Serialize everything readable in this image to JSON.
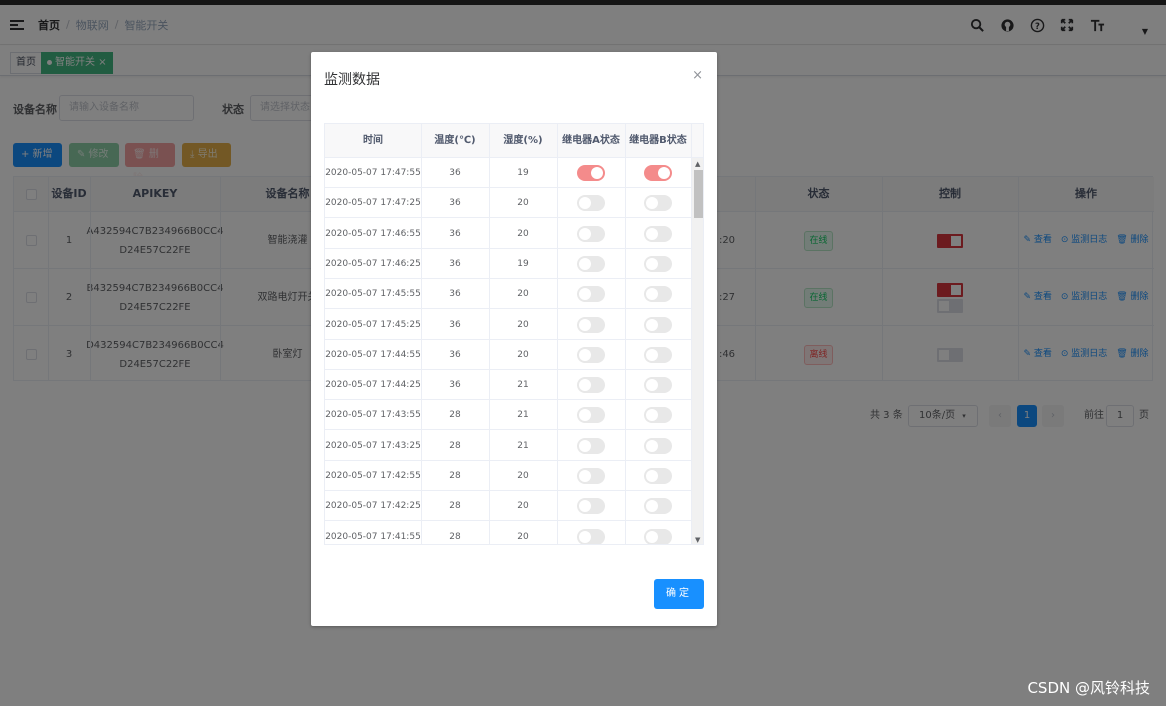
{
  "navbar": {
    "breadcrumbs": [
      "首页",
      "物联网",
      "智能开关"
    ]
  },
  "tags": [
    "首页",
    "智能开关"
  ],
  "search": {
    "device_name_label": "设备名称",
    "device_name_placeholder": "请输入设备名称",
    "status_label": "状态",
    "status_placeholder": "请选择状态"
  },
  "toolbar": {
    "add": "+ 新增",
    "edit": "✎ 修改",
    "delete": "🗑 删除",
    "export": "⤓ 导出"
  },
  "table": {
    "headers": [
      "设备ID",
      "APIKEY",
      "设备名称",
      "状态",
      "控制",
      "操作"
    ],
    "rows": [
      {
        "id": "1",
        "apikey_1": "A432594C7B234966B0CC4",
        "apikey_2": "D24E57C22FE",
        "name": "智能浇灌",
        "time_tail": ":20",
        "status": "在线",
        "status_type": "online",
        "switches": [
          "on"
        ]
      },
      {
        "id": "2",
        "apikey_1": "B432594C7B234966B0CC4",
        "apikey_2": "D24E57C22FE",
        "name": "双路电灯开关",
        "time_tail": ":27",
        "status": "在线",
        "status_type": "online",
        "switches": [
          "on",
          "off"
        ]
      },
      {
        "id": "3",
        "apikey_1": "D432594C7B234966B0CC4",
        "apikey_2": "D24E57C22FE",
        "name": "卧室灯",
        "time_tail": ":46",
        "status": "离线",
        "status_type": "offline",
        "switches": [
          "off"
        ]
      }
    ],
    "ops": [
      "✎ 查看",
      "⊙ 监测日志",
      "🗑 删除"
    ]
  },
  "pagination": {
    "total": "共 3 条",
    "page_size": "10条/页",
    "current_page": "1",
    "goto_label": "前往",
    "goto_value": "1",
    "page_suffix": "页"
  },
  "dialog": {
    "title": "监测数据",
    "close": "×",
    "headers": [
      "时间",
      "温度(℃)",
      "湿度(%)",
      "继电器A状态",
      "继电器B状态"
    ],
    "rows": [
      {
        "time": "2020-05-07 17:47:55",
        "temp": "36",
        "hum": "19",
        "a": true,
        "b": true
      },
      {
        "time": "2020-05-07 17:47:25",
        "temp": "36",
        "hum": "20",
        "a": false,
        "b": false
      },
      {
        "time": "2020-05-07 17:46:55",
        "temp": "36",
        "hum": "20",
        "a": false,
        "b": false
      },
      {
        "time": "2020-05-07 17:46:25",
        "temp": "36",
        "hum": "19",
        "a": false,
        "b": false
      },
      {
        "time": "2020-05-07 17:45:55",
        "temp": "36",
        "hum": "20",
        "a": false,
        "b": false
      },
      {
        "time": "2020-05-07 17:45:25",
        "temp": "36",
        "hum": "20",
        "a": false,
        "b": false
      },
      {
        "time": "2020-05-07 17:44:55",
        "temp": "36",
        "hum": "20",
        "a": false,
        "b": false
      },
      {
        "time": "2020-05-07 17:44:25",
        "temp": "36",
        "hum": "21",
        "a": false,
        "b": false
      },
      {
        "time": "2020-05-07 17:43:55",
        "temp": "28",
        "hum": "21",
        "a": false,
        "b": false
      },
      {
        "time": "2020-05-07 17:43:25",
        "temp": "28",
        "hum": "21",
        "a": false,
        "b": false
      },
      {
        "time": "2020-05-07 17:42:55",
        "temp": "28",
        "hum": "20",
        "a": false,
        "b": false
      },
      {
        "time": "2020-05-07 17:42:25",
        "temp": "28",
        "hum": "20",
        "a": false,
        "b": false
      },
      {
        "time": "2020-05-07 17:41:55",
        "temp": "28",
        "hum": "20",
        "a": false,
        "b": false
      }
    ],
    "confirm": "确定"
  },
  "watermark": "CSDN @风铃科技",
  "colors": {
    "primary": "#1890ff",
    "tag_active": "#42b983",
    "switch_on": "#f48b8b",
    "control_on": "#d9363e"
  }
}
